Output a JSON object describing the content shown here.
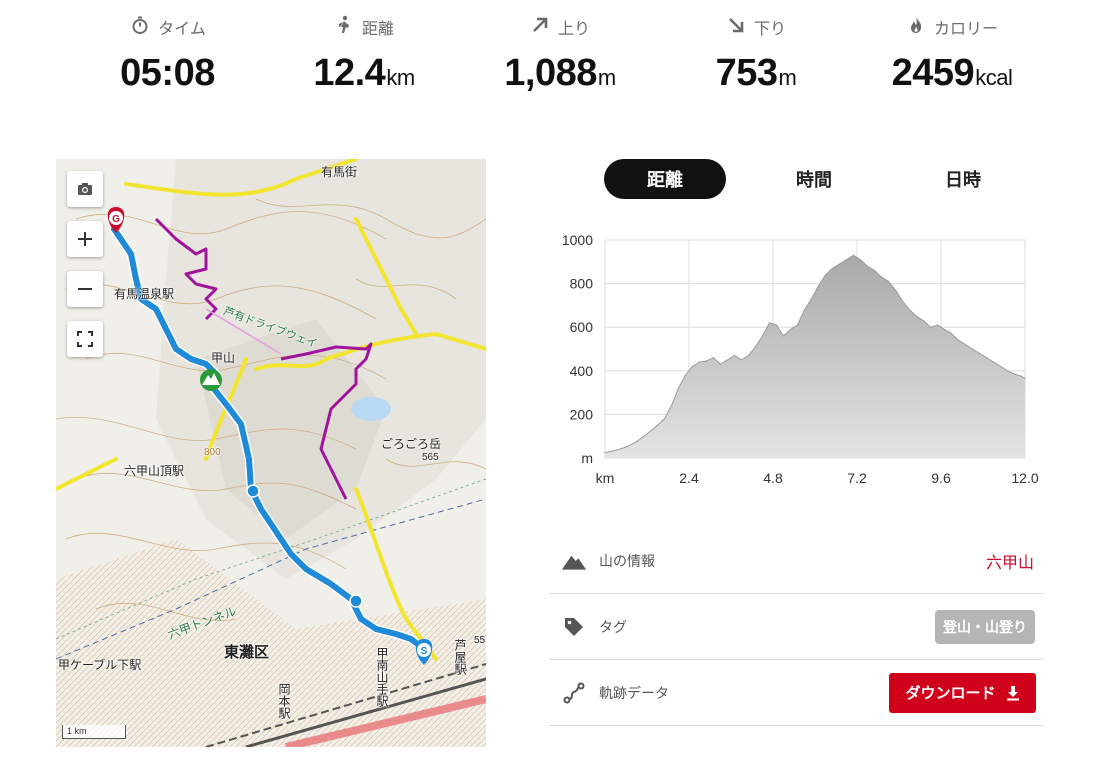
{
  "stats": [
    {
      "key": "time",
      "label": "タイム",
      "value": "05:08",
      "unit": "",
      "icon": "stopwatch-icon"
    },
    {
      "key": "distance",
      "label": "距離",
      "value": "12.4",
      "unit": "km",
      "icon": "walker-icon"
    },
    {
      "key": "ascent",
      "label": "上り",
      "value": "1,088",
      "unit": "m",
      "icon": "arrow-up-right-icon"
    },
    {
      "key": "descent",
      "label": "下り",
      "value": "753",
      "unit": "m",
      "icon": "arrow-down-right-icon"
    },
    {
      "key": "calories",
      "label": "カロリー",
      "value": "2459",
      "unit": "kcal",
      "icon": "flame-icon"
    }
  ],
  "tabs": [
    {
      "label": "距離",
      "active": true
    },
    {
      "label": "時間",
      "active": false
    },
    {
      "label": "日時",
      "active": false
    }
  ],
  "map": {
    "scale_label": "1 km",
    "labels": {
      "arima_onsen": "有馬温泉駅",
      "arima_kaido": "有馬街",
      "rokko_sancho": "六甲山頂駅",
      "cable_shita": "甲ケーブル下駅",
      "higashinada": "東灘区",
      "rokko_tunnel": "六甲トンネル",
      "gorogoro": "ごろごろ岳",
      "alt_565": "565",
      "alt_800": "800",
      "alt_55": "55",
      "ashiya": "芦屋駅",
      "konan_yamate": "甲南山手駅",
      "okamoto": "岡本駅",
      "drive_way": "芦有ドライブウェイ",
      "kouyama": "甲山",
      "goal_marker": "G",
      "start_marker": "S"
    },
    "controls": [
      "camera-icon",
      "zoom-in-icon",
      "zoom-out-icon",
      "fullscreen-icon"
    ]
  },
  "chart_data": {
    "type": "area",
    "title": "",
    "xlabel": "km",
    "ylabel": "m",
    "xlim": [
      0,
      12.0
    ],
    "ylim": [
      0,
      1000
    ],
    "x_ticks": [
      "2.4",
      "4.8",
      "7.2",
      "9.6",
      "12.0"
    ],
    "y_ticks": [
      "200",
      "400",
      "600",
      "800",
      "1000"
    ],
    "x": [
      0,
      0.3,
      0.6,
      0.9,
      1.2,
      1.5,
      1.7,
      1.9,
      2.1,
      2.3,
      2.5,
      2.7,
      2.9,
      3.1,
      3.3,
      3.5,
      3.7,
      3.9,
      4.1,
      4.3,
      4.5,
      4.7,
      4.9,
      5.1,
      5.3,
      5.5,
      5.7,
      5.9,
      6.1,
      6.3,
      6.5,
      6.7,
      6.9,
      7.1,
      7.3,
      7.5,
      7.7,
      7.9,
      8.1,
      8.3,
      8.5,
      8.7,
      8.9,
      9.1,
      9.3,
      9.5,
      9.7,
      9.9,
      10.1,
      10.3,
      10.5,
      10.7,
      10.9,
      11.1,
      11.3,
      11.5,
      11.7,
      11.9,
      12.0
    ],
    "y": [
      25,
      35,
      50,
      75,
      110,
      150,
      180,
      240,
      320,
      380,
      420,
      440,
      445,
      460,
      430,
      450,
      470,
      450,
      470,
      510,
      560,
      620,
      610,
      560,
      590,
      610,
      680,
      730,
      790,
      840,
      870,
      890,
      910,
      930,
      910,
      880,
      860,
      830,
      810,
      770,
      720,
      680,
      650,
      630,
      600,
      610,
      590,
      570,
      540,
      520,
      500,
      480,
      460,
      440,
      420,
      400,
      385,
      375,
      365
    ],
    "grid": true,
    "color": "#b8b8b8"
  },
  "info": {
    "mountain": {
      "label": "山の情報",
      "value": "六甲山"
    },
    "tags": {
      "label": "タグ",
      "value": "登山・山登り"
    },
    "track": {
      "label": "軌跡データ",
      "button": "ダウンロード"
    }
  },
  "colors": {
    "accent_red": "#c8102e",
    "download_red": "#d0021b",
    "route_blue": "#1f8ad8",
    "alt_route_purple": "#a0139c",
    "road_yellow": "#f2e530"
  }
}
